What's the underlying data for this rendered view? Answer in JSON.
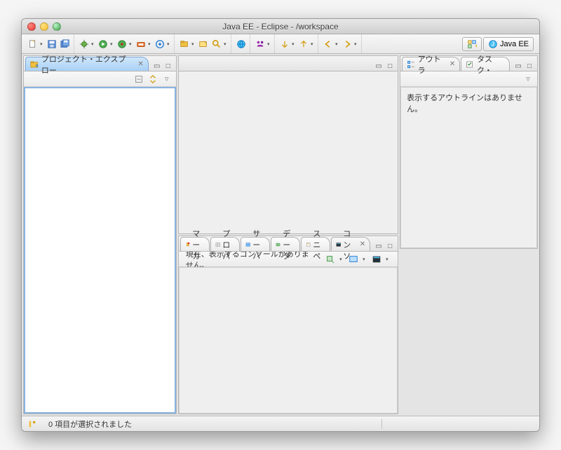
{
  "window": {
    "title": "Java EE - Eclipse - /workspace"
  },
  "perspective": {
    "label": "Java EE"
  },
  "left": {
    "tab": "プロジェクト・エクスプロー"
  },
  "right": {
    "outline_tab": "アウトラ",
    "tasks_tab": "タスク・",
    "outline_empty": "表示するアウトラインはありません。"
  },
  "bottom": {
    "tabs": {
      "markers": "マーカ",
      "properties": "プロパ",
      "servers": "サーバ",
      "data": "データ",
      "snippets": "スニペ",
      "console": "コンソ"
    },
    "console_empty": "現在、表示するコンソールがありません。"
  },
  "status": {
    "selection": "0 項目が選択されました"
  }
}
